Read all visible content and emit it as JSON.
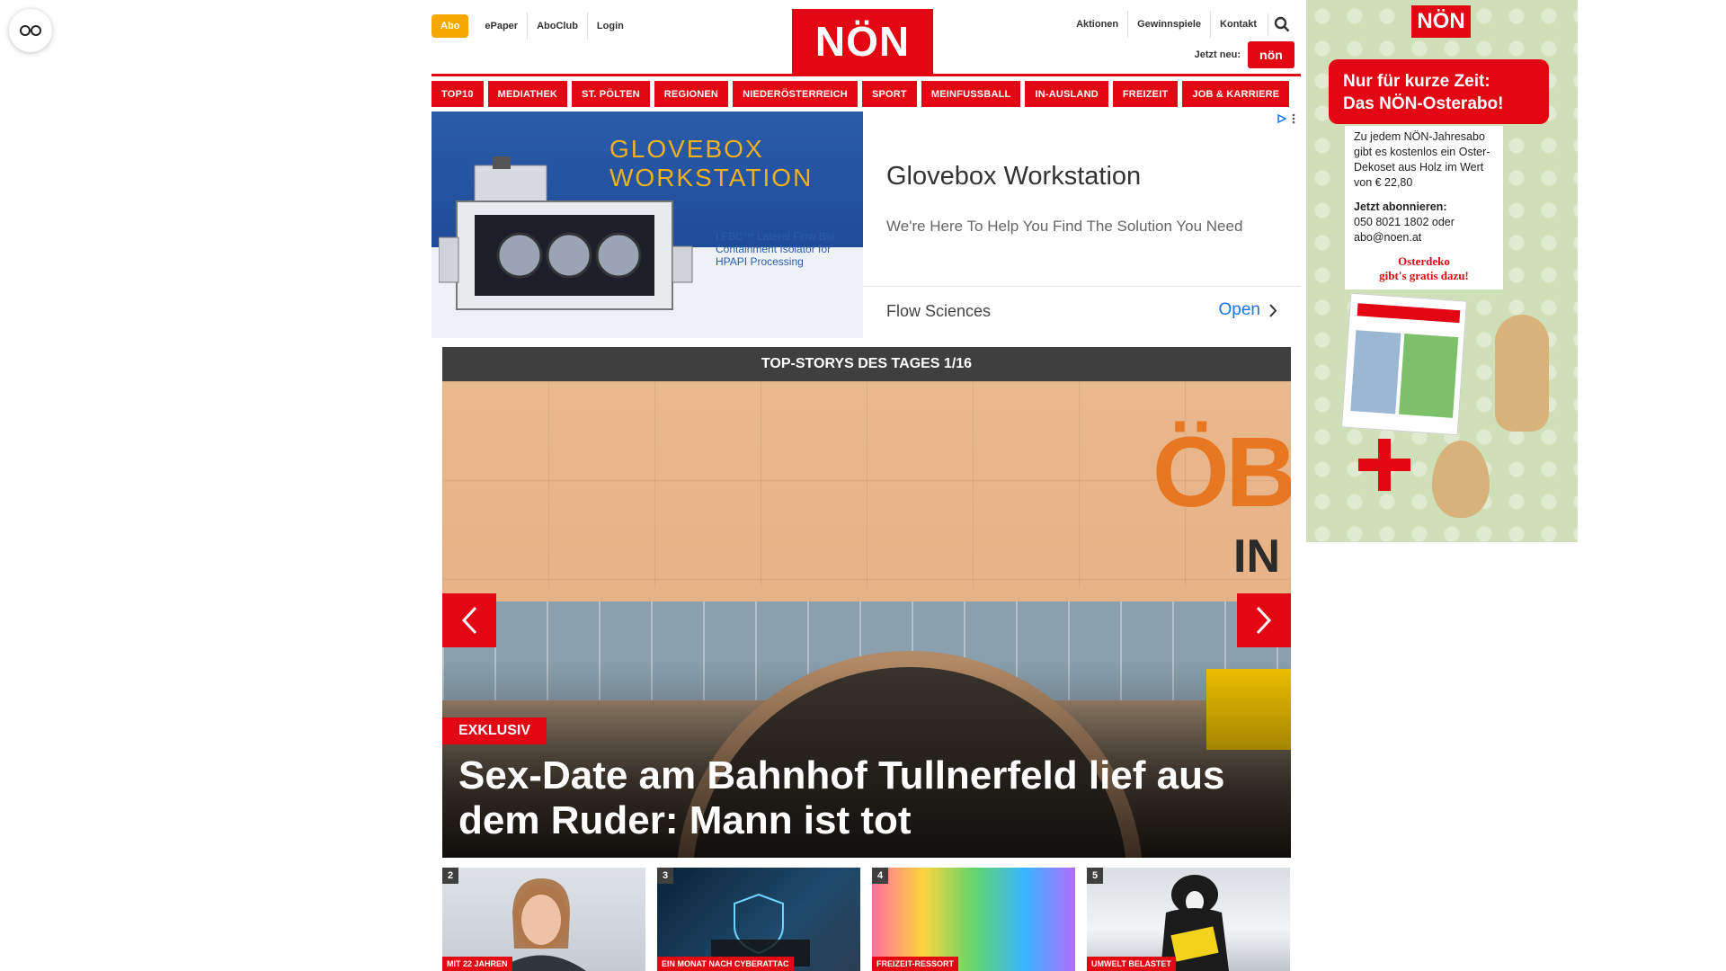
{
  "header": {
    "abo_label": "Abo",
    "epaper_label": "ePaper",
    "aboclub_label": "AboClub",
    "login_label": "Login",
    "logo_text": "NÖN",
    "aktionen_label": "Aktionen",
    "gewinnspiele_label": "Gewinnspiele",
    "kontakt_label": "Kontakt",
    "jetzt_neu_label": "Jetzt neu:",
    "jetzt_neu_badge": "nön"
  },
  "nav": {
    "items": [
      "TOP10",
      "MEDIATHEK",
      "ST. PÖLTEN",
      "REGIONEN",
      "NIEDERÖSTERREICH",
      "SPORT",
      "MEINFUSSBALL",
      "IN-AUSLAND",
      "FREIZEIT",
      "JOB & KARRIERE"
    ]
  },
  "ad_banner": {
    "image_title_line1": "GLOVEBOX",
    "image_title_line2": "WORKSTATION",
    "image_sub": "LFBC™ Lateral Flow Bio Containment Isolator for HPAPI Processing",
    "title": "Glovebox Workstation",
    "description": "We're Here To Help You Find The Solution You Need",
    "advertiser": "Flow Sciences",
    "open_label": "Open"
  },
  "slider": {
    "header": "TOP-STORYS DES TAGES 1/16",
    "tag": "EXKLUSIV",
    "headline": "Sex-Date am Bahnhof Tullnerfeld lief aus dem Ruder: Mann ist tot",
    "image_sign": "ÖB",
    "image_sign2": "IN"
  },
  "thumbs": [
    {
      "num": "2",
      "tag": "MIT 22 JAHREN"
    },
    {
      "num": "3",
      "tag": "EIN MONAT NACH CYBERATTAC"
    },
    {
      "num": "4",
      "tag": "FREIZEIT-RESSORT"
    },
    {
      "num": "5",
      "tag": "UMWELT BELASTET"
    }
  ],
  "side_ad": {
    "logo": "NÖN",
    "banner_line1": "Nur für kurze Zeit:",
    "banner_line2": "Das NÖN-Osterabo!",
    "card_text": "Zu jedem NÖN-Jahresabo gibt es kostenlos ein Oster-Dekoset aus Holz im Wert von € 22,80",
    "card_bold": "Jetzt abonnieren:",
    "card_contact": "050 8021 1802 oder abo@noen.at",
    "card_red_line1": "Osterdeko",
    "card_red_line2": "gibt's gratis dazu!"
  },
  "colors": {
    "brand_red": "#e30613",
    "abo_orange": "#f5a800",
    "slider_header": "#3f3f3f"
  }
}
